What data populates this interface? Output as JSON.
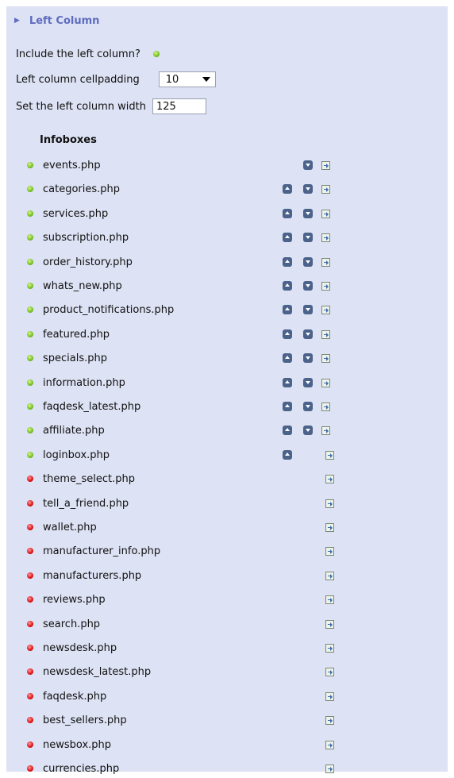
{
  "section": {
    "title": "Left Column"
  },
  "settings": {
    "include_label": "Include the left column?",
    "cellpadding_label": "Left column cellpadding",
    "cellpadding_value": "10",
    "width_label": "Set the left column width",
    "width_value": "125"
  },
  "infoboxes": {
    "heading": "Infoboxes",
    "items": [
      {
        "name": "events.php",
        "active": true,
        "up": false,
        "down": true
      },
      {
        "name": "categories.php",
        "active": true,
        "up": true,
        "down": true
      },
      {
        "name": "services.php",
        "active": true,
        "up": true,
        "down": true
      },
      {
        "name": "subscription.php",
        "active": true,
        "up": true,
        "down": true
      },
      {
        "name": "order_history.php",
        "active": true,
        "up": true,
        "down": true
      },
      {
        "name": "whats_new.php",
        "active": true,
        "up": true,
        "down": true
      },
      {
        "name": "product_notifications.php",
        "active": true,
        "up": true,
        "down": true
      },
      {
        "name": "featured.php",
        "active": true,
        "up": true,
        "down": true
      },
      {
        "name": "specials.php",
        "active": true,
        "up": true,
        "down": true
      },
      {
        "name": "information.php",
        "active": true,
        "up": true,
        "down": true
      },
      {
        "name": "faqdesk_latest.php",
        "active": true,
        "up": true,
        "down": true
      },
      {
        "name": "affiliate.php",
        "active": true,
        "up": true,
        "down": true
      },
      {
        "name": "loginbox.php",
        "active": true,
        "up": true,
        "down": false
      },
      {
        "name": "theme_select.php",
        "active": false,
        "up": false,
        "down": false
      },
      {
        "name": "tell_a_friend.php",
        "active": false,
        "up": false,
        "down": false
      },
      {
        "name": "wallet.php",
        "active": false,
        "up": false,
        "down": false
      },
      {
        "name": "manufacturer_info.php",
        "active": false,
        "up": false,
        "down": false
      },
      {
        "name": "manufacturers.php",
        "active": false,
        "up": false,
        "down": false
      },
      {
        "name": "reviews.php",
        "active": false,
        "up": false,
        "down": false
      },
      {
        "name": "search.php",
        "active": false,
        "up": false,
        "down": false
      },
      {
        "name": "newsdesk.php",
        "active": false,
        "up": false,
        "down": false
      },
      {
        "name": "newsdesk_latest.php",
        "active": false,
        "up": false,
        "down": false
      },
      {
        "name": "faqdesk.php",
        "active": false,
        "up": false,
        "down": false
      },
      {
        "name": "best_sellers.php",
        "active": false,
        "up": false,
        "down": false
      },
      {
        "name": "newsbox.php",
        "active": false,
        "up": false,
        "down": false
      },
      {
        "name": "currencies.php",
        "active": false,
        "up": false,
        "down": false
      }
    ]
  },
  "icons": {
    "active": "green-dot-icon",
    "inactive": "red-dot-icon",
    "up": "arrow-up-icon",
    "down": "arrow-down-icon",
    "move": "move-to-column-icon"
  },
  "colors": {
    "panel_bg": "#dde2f4",
    "header_text": "#5f6cc0",
    "active": "#7ac427",
    "inactive": "#e0181c",
    "arrow_button": "#4b628a"
  }
}
